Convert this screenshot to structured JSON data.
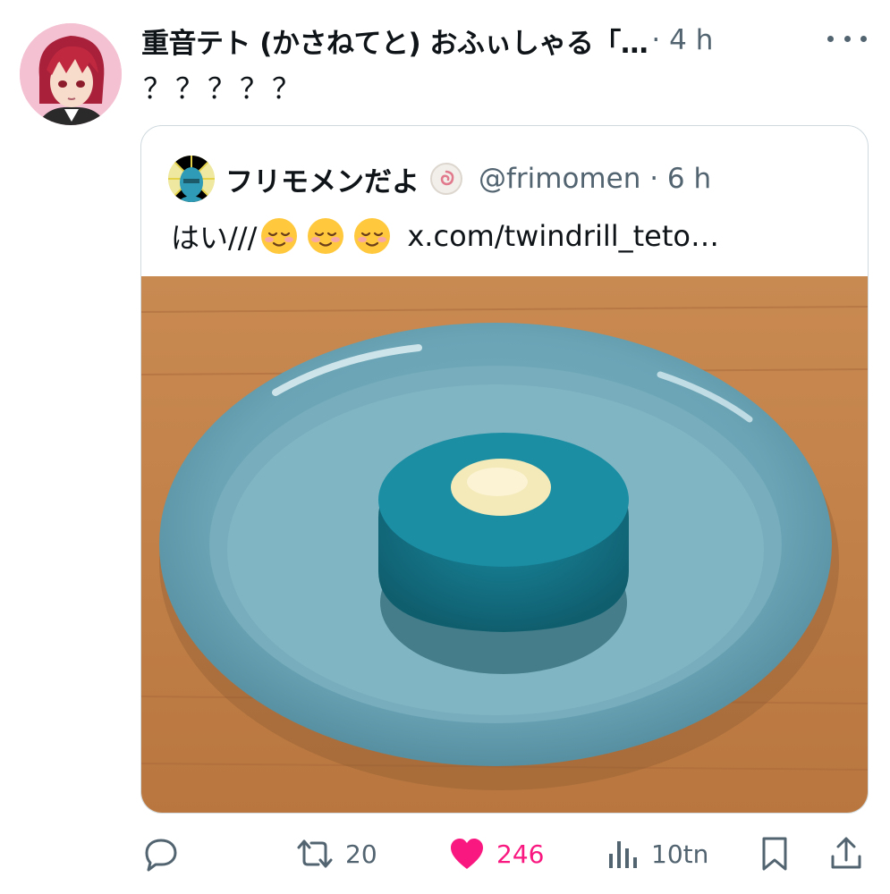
{
  "tweet": {
    "author_name": "重音テト (かさねてと) おふぃしゃる「…",
    "meta": "· 4 h",
    "text": "？？？？？"
  },
  "quote": {
    "author_name": "フリモメンだよ",
    "handle": "@frimomen · 6 h",
    "text_prefix": "はい///",
    "link": "x.com/twindrill_teto…"
  },
  "actions": {
    "retweets": "20",
    "likes": "246",
    "views": "10tn"
  },
  "colors": {
    "like": "#f91880",
    "secondary_text": "#536471",
    "border": "#cfd9de"
  }
}
